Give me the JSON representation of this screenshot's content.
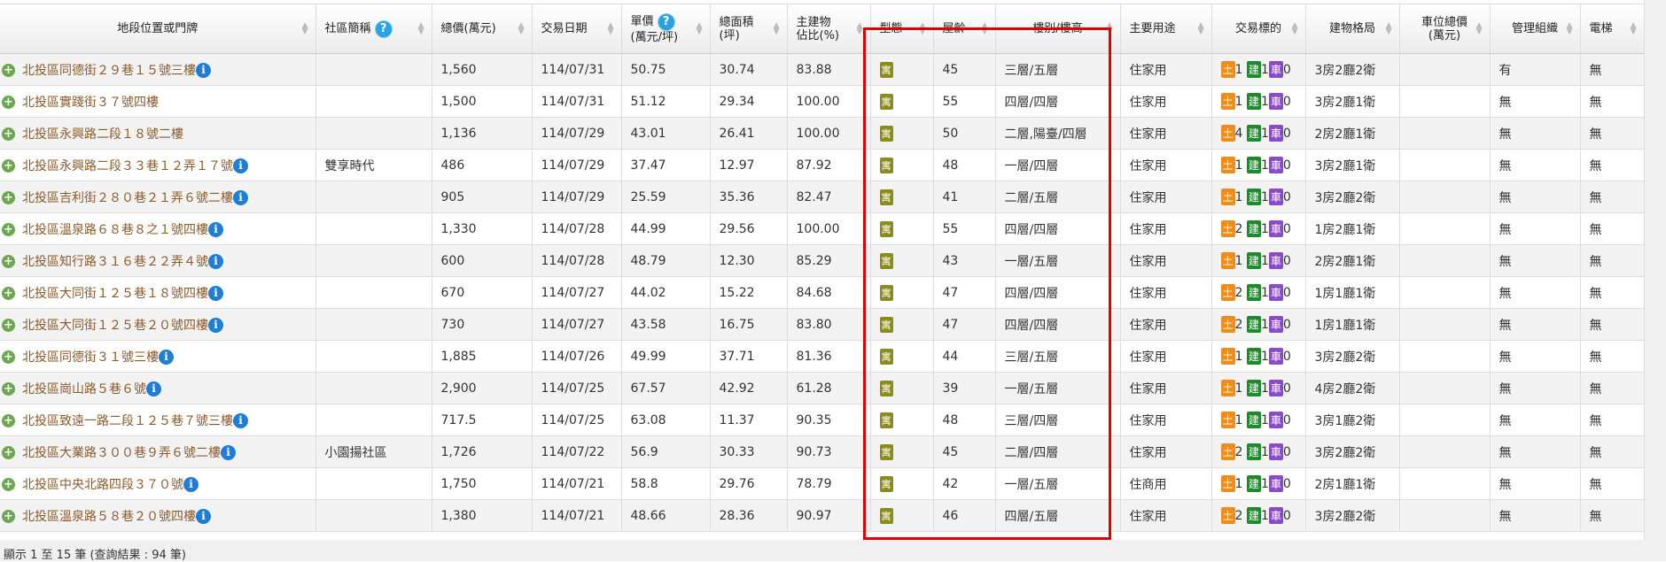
{
  "headers": [
    {
      "label": "地段位置或門牌",
      "align": "c",
      "help": false
    },
    {
      "label": "社區簡稱",
      "help": true
    },
    {
      "label": "總價(萬元)"
    },
    {
      "label": "交易日期"
    },
    {
      "label": "單價",
      "label2": "(萬元/坪)",
      "help": true
    },
    {
      "label": "總面積",
      "label2": "(坪)"
    },
    {
      "label": "主建物",
      "label2": "佔比(%)"
    },
    {
      "label": "型態"
    },
    {
      "label": "屋齡"
    },
    {
      "label": "樓別/樓高",
      "align": "c"
    },
    {
      "label": "主要用途"
    },
    {
      "label": "交易標的",
      "align": "c"
    },
    {
      "label": "建物格局",
      "align": "c"
    },
    {
      "label": "車位總價",
      "label2": "(萬元)",
      "align": "c"
    },
    {
      "label": "管理組織",
      "align": "c"
    },
    {
      "label": "電梯"
    }
  ],
  "badge_labels": {
    "land": "土",
    "building": "建",
    "parking": "車"
  },
  "rows": [
    {
      "addr": "北投區同德街２９巷１５號三樓",
      "info": true,
      "community": "",
      "price": "1,560",
      "date": "114/07/31",
      "unit": "50.75",
      "area": "30.74",
      "ratio": "83.88",
      "type": "寓",
      "age": "45",
      "floor": "三層/五層",
      "use": "住家用",
      "land": "1",
      "bld": "1",
      "park": "0",
      "layout": "3房2廳2衛",
      "parking_price": "",
      "mgmt": "有",
      "elevator": "無"
    },
    {
      "addr": "北投區實踐街３７號四樓",
      "info": false,
      "community": "",
      "price": "1,500",
      "date": "114/07/31",
      "unit": "51.12",
      "area": "29.34",
      "ratio": "100.00",
      "type": "寓",
      "age": "55",
      "floor": "四層/四層",
      "use": "住家用",
      "land": "1",
      "bld": "1",
      "park": "0",
      "layout": "3房2廳1衛",
      "parking_price": "",
      "mgmt": "無",
      "elevator": "無"
    },
    {
      "addr": "北投區永興路二段１８號二樓",
      "info": false,
      "community": "",
      "price": "1,136",
      "date": "114/07/29",
      "unit": "43.01",
      "area": "26.41",
      "ratio": "100.00",
      "type": "寓",
      "age": "50",
      "floor": "二層,陽臺/四層",
      "use": "住家用",
      "land": "4",
      "bld": "1",
      "park": "0",
      "layout": "2房2廳1衛",
      "parking_price": "",
      "mgmt": "無",
      "elevator": "無"
    },
    {
      "addr": "北投區永興路二段３３巷１２弄１７號",
      "info": true,
      "community": "雙享時代",
      "price": "486",
      "date": "114/07/29",
      "unit": "37.47",
      "area": "12.97",
      "ratio": "87.92",
      "type": "寓",
      "age": "48",
      "floor": "一層/四層",
      "use": "住家用",
      "land": "1",
      "bld": "1",
      "park": "0",
      "layout": "3房2廳1衛",
      "parking_price": "",
      "mgmt": "無",
      "elevator": "無"
    },
    {
      "addr": "北投區吉利街２８０巷２１弄６號二樓",
      "info": true,
      "community": "",
      "price": "905",
      "date": "114/07/29",
      "unit": "25.59",
      "area": "35.36",
      "ratio": "82.47",
      "type": "寓",
      "age": "41",
      "floor": "二層/五層",
      "use": "住家用",
      "land": "1",
      "bld": "1",
      "park": "0",
      "layout": "3房2廳2衛",
      "parking_price": "",
      "mgmt": "無",
      "elevator": "無"
    },
    {
      "addr": "北投區溫泉路６８巷８之１號四樓",
      "info": true,
      "community": "",
      "price": "1,330",
      "date": "114/07/28",
      "unit": "44.99",
      "area": "29.56",
      "ratio": "100.00",
      "type": "寓",
      "age": "55",
      "floor": "四層/四層",
      "use": "住家用",
      "land": "2",
      "bld": "1",
      "park": "0",
      "layout": "1房2廳1衛",
      "parking_price": "",
      "mgmt": "無",
      "elevator": "無"
    },
    {
      "addr": "北投區知行路３１６巷２２弄４號",
      "info": true,
      "community": "",
      "price": "600",
      "date": "114/07/28",
      "unit": "48.79",
      "area": "12.30",
      "ratio": "85.29",
      "type": "寓",
      "age": "43",
      "floor": "一層/五層",
      "use": "住家用",
      "land": "1",
      "bld": "1",
      "park": "0",
      "layout": "2房2廳1衛",
      "parking_price": "",
      "mgmt": "無",
      "elevator": "無"
    },
    {
      "addr": "北投區大同街１２５巷１８號四樓",
      "info": true,
      "community": "",
      "price": "670",
      "date": "114/07/27",
      "unit": "44.02",
      "area": "15.22",
      "ratio": "84.68",
      "type": "寓",
      "age": "47",
      "floor": "四層/四層",
      "use": "住家用",
      "land": "2",
      "bld": "1",
      "park": "0",
      "layout": "1房1廳1衛",
      "parking_price": "",
      "mgmt": "無",
      "elevator": "無"
    },
    {
      "addr": "北投區大同街１２５巷２０號四樓",
      "info": true,
      "community": "",
      "price": "730",
      "date": "114/07/27",
      "unit": "43.58",
      "area": "16.75",
      "ratio": "83.80",
      "type": "寓",
      "age": "47",
      "floor": "四層/四層",
      "use": "住家用",
      "land": "2",
      "bld": "1",
      "park": "0",
      "layout": "1房1廳1衛",
      "parking_price": "",
      "mgmt": "無",
      "elevator": "無"
    },
    {
      "addr": "北投區同德街３１號三樓",
      "info": true,
      "community": "",
      "price": "1,885",
      "date": "114/07/26",
      "unit": "49.99",
      "area": "37.71",
      "ratio": "81.36",
      "type": "寓",
      "age": "44",
      "floor": "三層/五層",
      "use": "住家用",
      "land": "1",
      "bld": "1",
      "park": "0",
      "layout": "3房2廳2衛",
      "parking_price": "",
      "mgmt": "無",
      "elevator": "無"
    },
    {
      "addr": "北投區崗山路５巷６號",
      "info": true,
      "community": "",
      "price": "2,900",
      "date": "114/07/25",
      "unit": "67.57",
      "area": "42.92",
      "ratio": "61.28",
      "type": "寓",
      "age": "39",
      "floor": "一層/五層",
      "use": "住家用",
      "land": "1",
      "bld": "1",
      "park": "0",
      "layout": "4房2廳2衛",
      "parking_price": "",
      "mgmt": "無",
      "elevator": "無"
    },
    {
      "addr": "北投區致遠一路二段１２５巷７號三樓",
      "info": true,
      "community": "",
      "price": "717.5",
      "date": "114/07/25",
      "unit": "63.08",
      "area": "11.37",
      "ratio": "90.35",
      "type": "寓",
      "age": "48",
      "floor": "三層/四層",
      "use": "住家用",
      "land": "1",
      "bld": "1",
      "park": "0",
      "layout": "3房1廳2衛",
      "parking_price": "",
      "mgmt": "無",
      "elevator": "無"
    },
    {
      "addr": "北投區大業路３００巷９弄６號二樓",
      "info": true,
      "community": "小園揚社區",
      "price": "1,726",
      "date": "114/07/22",
      "unit": "56.9",
      "area": "30.33",
      "ratio": "90.73",
      "type": "寓",
      "age": "45",
      "floor": "二層/四層",
      "use": "住家用",
      "land": "2",
      "bld": "1",
      "park": "0",
      "layout": "3房2廳2衛",
      "parking_price": "",
      "mgmt": "無",
      "elevator": "無"
    },
    {
      "addr": "北投區中央北路四段３７０號",
      "info": true,
      "community": "",
      "price": "1,750",
      "date": "114/07/21",
      "unit": "58.8",
      "area": "29.76",
      "ratio": "78.79",
      "type": "寓",
      "age": "42",
      "floor": "一層/五層",
      "use": "住商用",
      "land": "1",
      "bld": "1",
      "park": "0",
      "layout": "2房1廳1衛",
      "parking_price": "",
      "mgmt": "無",
      "elevator": "無"
    },
    {
      "addr": "北投區溫泉路５８巷２０號四樓",
      "info": true,
      "community": "",
      "price": "1,380",
      "date": "114/07/21",
      "unit": "48.66",
      "area": "28.36",
      "ratio": "90.97",
      "type": "寓",
      "age": "46",
      "floor": "四層/五層",
      "use": "住家用",
      "land": "2",
      "bld": "1",
      "park": "0",
      "layout": "3房2廳2衛",
      "parking_price": "",
      "mgmt": "無",
      "elevator": "無"
    }
  ],
  "footer": {
    "summary": "顯示 1 至 15 筆 (查詢結果 : 94 筆)"
  }
}
